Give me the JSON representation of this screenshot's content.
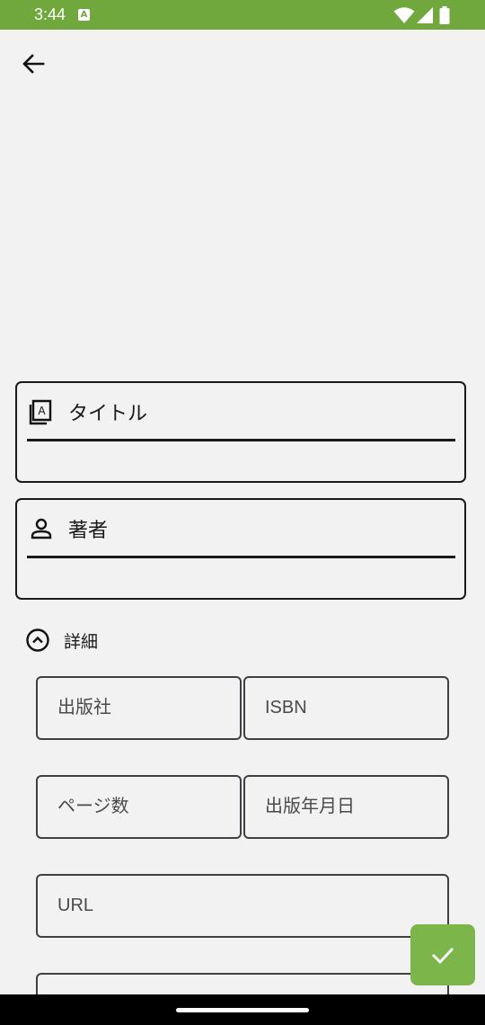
{
  "status_bar": {
    "time": "3:44",
    "notification_glyph": "A",
    "icons": [
      "wifi-icon",
      "signal-icon",
      "battery-icon"
    ],
    "color": "#70a83e"
  },
  "toolbar": {
    "back_icon": "arrow-left-icon"
  },
  "form": {
    "title_field": {
      "label": "タイトル",
      "icon": "book-icon"
    },
    "author_field": {
      "label": "著者",
      "icon": "person-icon"
    }
  },
  "details": {
    "toggle_label": "詳細",
    "toggle_icon": "chevron-up-circle-icon",
    "fields": {
      "publisher": "出版社",
      "isbn": "ISBN",
      "pages": "ページ数",
      "publish_date": "出版年月日",
      "url": "URL"
    }
  },
  "fab": {
    "icon": "check-icon",
    "color": "#7cb64b"
  }
}
